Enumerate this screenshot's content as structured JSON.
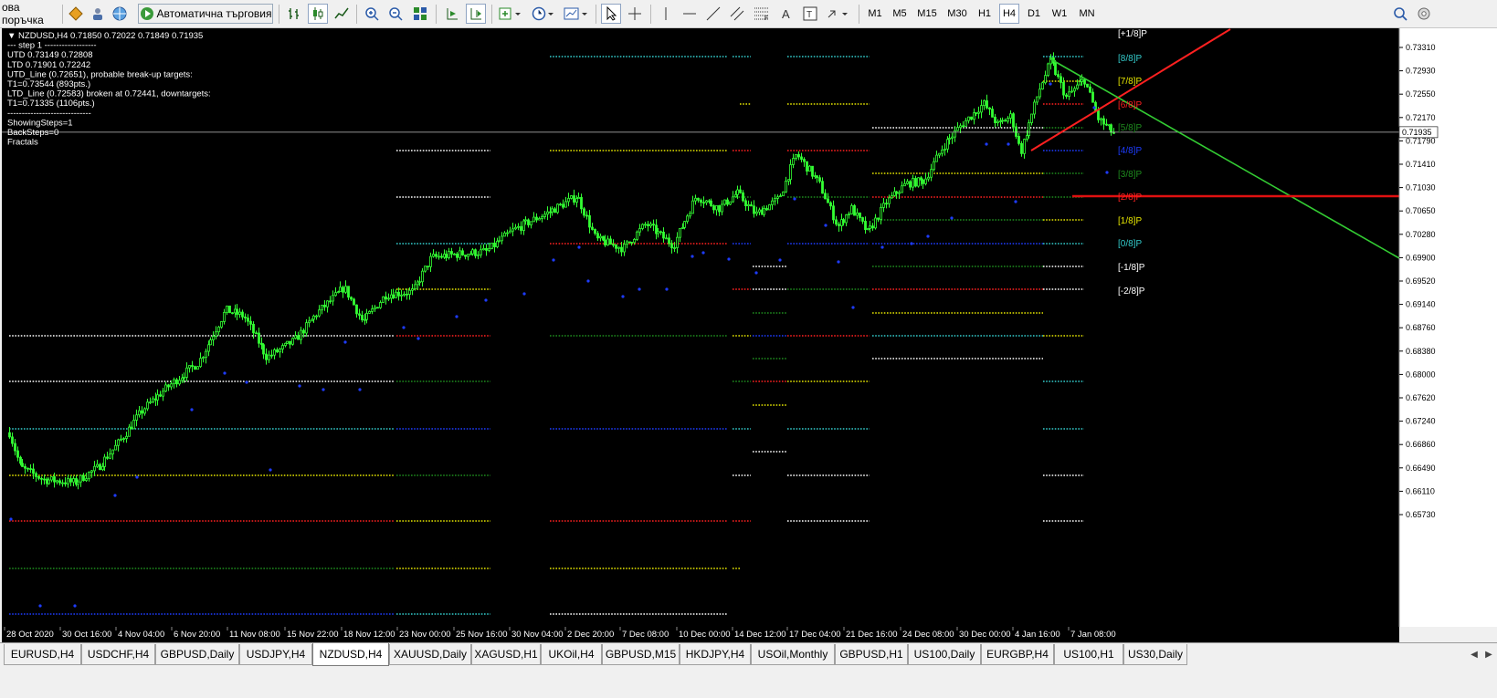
{
  "toolbar": {
    "new_order_label": "ова поръчка",
    "autotrading_label": "Автоматична търговия",
    "timeframes": [
      "M1",
      "M5",
      "M15",
      "M30",
      "H1",
      "H4",
      "D1",
      "W1",
      "MN"
    ],
    "active_timeframe": "H4",
    "icons": [
      "diamond-icon",
      "people-icon",
      "globe-icon",
      "autotrading-icon",
      "bar-chart-icon",
      "candles-icon",
      "line-chart-icon",
      "zoom-in-icon",
      "zoom-out-icon",
      "tile-icon",
      "autoscroll-icon",
      "chart-shift-icon",
      "indicators-icon",
      "periods-icon",
      "templates-icon",
      "cursor-icon",
      "crosshair-icon",
      "vertical-line-icon",
      "horizontal-line-icon",
      "trendline-icon",
      "channel-icon",
      "fibo-icon",
      "text-icon",
      "label-icon",
      "arrows-icon",
      "search-icon"
    ]
  },
  "chart": {
    "info_lines": [
      "▼ NZDUSD,H4  0.71850 0.72022 0.71849 0.71935",
      "---   step 1   ------------------",
      "UTD 0.73149  0.72808",
      "LTD  0.71901  0.72242",
      "UTD_Line (0.72651), probable break-up targets:",
      "T1=0.73544 (893pts.)",
      "LTD_Line (0.72583) broken at 0.72441, downtargets:",
      "T1=0.71335 (1106pts.)",
      "-----------------------------",
      "ShowingSteps=1",
      "BackSteps=0",
      "Fractals"
    ],
    "current_price": "0.71935",
    "price_axis": [
      "0.73310",
      "0.72930",
      "0.72550",
      "0.72170",
      "0.71790",
      "0.71410",
      "0.71030",
      "0.70650",
      "0.70280",
      "0.69900",
      "0.69520",
      "0.69140",
      "0.68760",
      "0.68380",
      "0.68000",
      "0.67620",
      "0.67240",
      "0.66860",
      "0.66490",
      "0.66110",
      "0.65730"
    ],
    "time_axis": [
      "28 Oct 2020",
      "30 Oct 16:00",
      "4 Nov 04:00",
      "6 Nov 20:00",
      "11 Nov 08:00",
      "15 Nov 22:00",
      "18 Nov 12:00",
      "23 Nov 00:00",
      "25 Nov 16:00",
      "30 Nov 04:00",
      "2 Dec 20:00",
      "7 Dec 08:00",
      "10 Dec 00:00",
      "14 Dec 12:00",
      "17 Dec 04:00",
      "21 Dec 16:00",
      "24 Dec 08:00",
      "30 Dec 00:00",
      "4 Jan 16:00",
      "7 Jan 08:00"
    ],
    "murrey_labels": [
      {
        "text": "[+1/8]P",
        "color": "#ffffff"
      },
      {
        "text": "[8/8]P",
        "color": "#33cccc"
      },
      {
        "text": "[7/8]P",
        "color": "#e6e600"
      },
      {
        "text": "[6/8]P",
        "color": "#ff2020"
      },
      {
        "text": "[5/8]P",
        "color": "#1e8c1e"
      },
      {
        "text": "[4/8]P",
        "color": "#1e3cff"
      },
      {
        "text": "[3/8]P",
        "color": "#1e8c1e"
      },
      {
        "text": "[2/8]P",
        "color": "#ff2020"
      },
      {
        "text": "[1/8]P",
        "color": "#e6e600"
      },
      {
        "text": "[0/8]P",
        "color": "#33cccc"
      },
      {
        "text": "[-1/8]P",
        "color": "#ffffff"
      },
      {
        "text": "[-2/8]P",
        "color": "#ffffff"
      }
    ],
    "colors": {
      "background": "#000000",
      "candle": "#33ff33",
      "fractal": "#1e3cff",
      "utd_line": "#ff2020",
      "ltd_line": "#33cc33",
      "target_line": "#e01010",
      "price_line": "#c0c0c0"
    }
  },
  "tabs": [
    "EURUSD,H4",
    "USDCHF,H4",
    "GBPUSD,Daily",
    "USDJPY,H4",
    "NZDUSD,H4",
    "XAUUSD,Daily",
    "XAGUSD,H1",
    "UKOil,H4",
    "GBPUSD,M15",
    "HKDJPY,H4",
    "USOil,Monthly",
    "GBPUSD,H1",
    "US100,Daily",
    "EURGBP,H4",
    "US100,H1",
    "US30,Daily"
  ],
  "active_tab": "NZDUSD,H4"
}
